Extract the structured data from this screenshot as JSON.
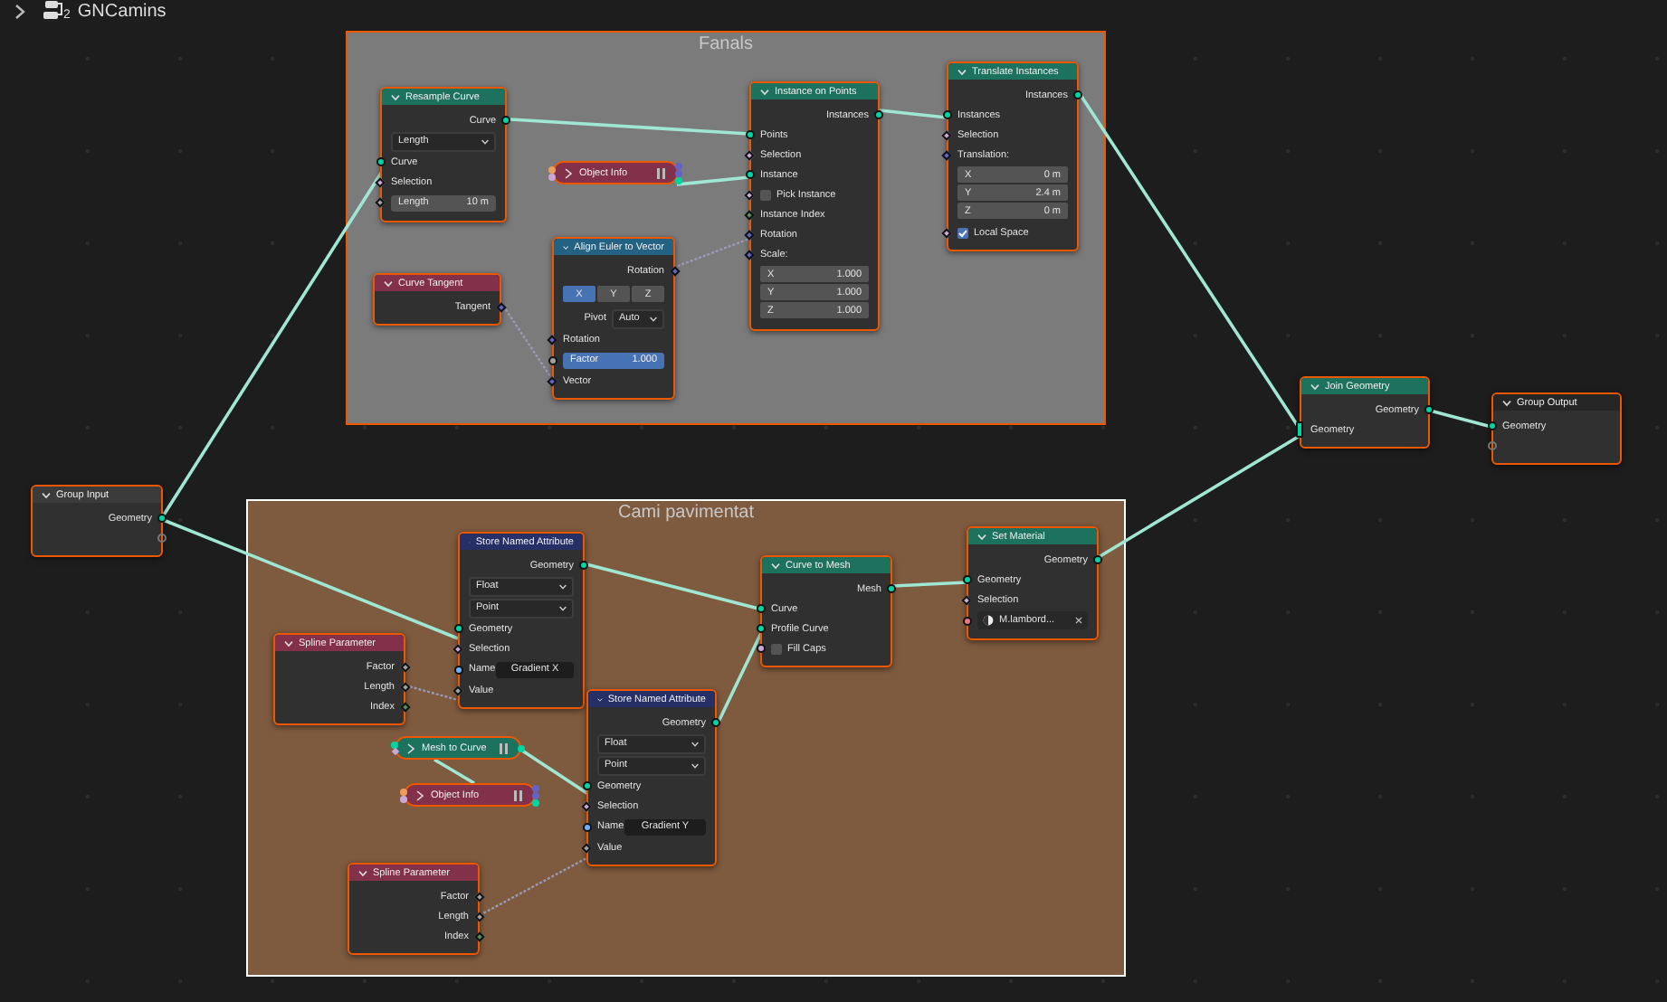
{
  "breadcrumb": {
    "name": "GNCamins",
    "users": "2"
  },
  "frames": [
    {
      "label": "Fanals",
      "color": "#7b7b7b",
      "active": false
    },
    {
      "label": "Cami pavimentat",
      "color": "#7e5a3e",
      "active": true
    }
  ],
  "nodes": [
    {
      "title": "Resample Curve",
      "color": "#1d725e",
      "selected": true,
      "collapsed": false,
      "rows": [
        {
          "kind": "output",
          "label": "Curve",
          "socket": {
            "kind": "circle",
            "color": "#00d6a3"
          }
        },
        {
          "kind": "dropdown",
          "value": "Length"
        },
        {
          "kind": "input",
          "label": "Curve",
          "socket": {
            "kind": "circle",
            "color": "#00d6a3"
          }
        },
        {
          "kind": "input",
          "label": "Selection",
          "socket": {
            "kind": "diamond",
            "color": "#cca6d6"
          }
        },
        {
          "kind": "number",
          "label": "Length",
          "value": "10 m",
          "socket": {
            "kind": "diamond",
            "color": "#a1a1a1"
          }
        }
      ]
    },
    {
      "title": "Curve Tangent",
      "color": "#83314a",
      "selected": true,
      "collapsed": false,
      "rows": [
        {
          "kind": "output",
          "label": "Tangent",
          "socket": {
            "kind": "diamond",
            "color": "#6363c7"
          }
        }
      ]
    },
    {
      "title": "Object Info",
      "color": "#83314a",
      "selected": true,
      "collapsed": true,
      "inputs": [
        {
          "kind": "circle",
          "color": "#ed9e5c"
        },
        {
          "kind": "circle",
          "color": "#cca6d6"
        }
      ],
      "outputs": [
        {
          "kind": "circle",
          "color": "#6363c7"
        },
        {
          "kind": "circle",
          "color": "#6363c7"
        },
        {
          "kind": "circle",
          "color": "#00d6a3"
        }
      ]
    },
    {
      "title": "Align Euler to Vector",
      "color": "#246283",
      "selected": true,
      "collapsed": false,
      "rows": [
        {
          "kind": "output",
          "label": "Rotation",
          "socket": {
            "kind": "diamond",
            "color": "#6363c7"
          }
        },
        {
          "kind": "toggles",
          "items": [
            {
              "label": "X",
              "selected": true
            },
            {
              "label": "Y",
              "selected": false
            },
            {
              "label": "Z",
              "selected": false
            }
          ]
        },
        {
          "kind": "dropdown",
          "label": "Pivot",
          "value": "Auto"
        },
        {
          "kind": "input",
          "label": "Rotation",
          "socket": {
            "kind": "diamond",
            "color": "#6363c7"
          }
        },
        {
          "kind": "slider",
          "label": "Factor",
          "value": "1.000",
          "level": 1,
          "socket": {
            "kind": "circle",
            "color": "#a1a1a1"
          }
        },
        {
          "kind": "input",
          "label": "Vector",
          "socket": {
            "kind": "diamond",
            "color": "#6363c7"
          }
        }
      ]
    },
    {
      "title": "Instance on Points",
      "color": "#1d725e",
      "selected": true,
      "collapsed": false,
      "rows": [
        {
          "kind": "output",
          "label": "Instances",
          "socket": {
            "kind": "circle",
            "color": "#00d6a3"
          }
        },
        {
          "kind": "input",
          "label": "Points",
          "socket": {
            "kind": "circle",
            "color": "#00d6a3"
          }
        },
        {
          "kind": "input",
          "label": "Selection",
          "socket": {
            "kind": "diamond",
            "color": "#cca6d6"
          }
        },
        {
          "kind": "input",
          "label": "Instance",
          "socket": {
            "kind": "circle",
            "color": "#00d6a3"
          }
        },
        {
          "kind": "checkbox",
          "label": "Pick Instance",
          "checked": false,
          "socket": {
            "kind": "diamond",
            "color": "#cca6d6"
          }
        },
        {
          "kind": "input",
          "label": "Instance Index",
          "socket": {
            "kind": "diamond",
            "color": "#598c5c"
          }
        },
        {
          "kind": "input",
          "label": "Rotation",
          "socket": {
            "kind": "diamond",
            "color": "#6363c7"
          }
        },
        {
          "kind": "input",
          "label": "Scale:",
          "socket": {
            "kind": "diamond",
            "color": "#6363c7"
          }
        },
        {
          "kind": "vector",
          "items": [
            {
              "label": "X",
              "value": "1.000"
            },
            {
              "label": "Y",
              "value": "1.000"
            },
            {
              "label": "Z",
              "value": "1.000"
            }
          ]
        }
      ]
    },
    {
      "title": "Translate Instances",
      "color": "#1d725e",
      "selected": true,
      "collapsed": false,
      "rows": [
        {
          "kind": "output",
          "label": "Instances",
          "socket": {
            "kind": "circle",
            "color": "#00d6a3"
          }
        },
        {
          "kind": "input",
          "label": "Instances",
          "socket": {
            "kind": "circle",
            "color": "#00d6a3"
          }
        },
        {
          "kind": "input",
          "label": "Selection",
          "socket": {
            "kind": "diamond",
            "color": "#cca6d6"
          }
        },
        {
          "kind": "input",
          "label": "Translation:",
          "socket": {
            "kind": "diamond",
            "color": "#6363c7"
          }
        },
        {
          "kind": "vector",
          "items": [
            {
              "label": "X",
              "value": "0 m"
            },
            {
              "label": "Y",
              "value": "2.4 m"
            },
            {
              "label": "Z",
              "value": "0 m"
            }
          ]
        },
        {
          "kind": "checkbox",
          "label": "Local Space",
          "checked": true,
          "socket": {
            "kind": "diamond",
            "color": "#cca6d6"
          }
        }
      ]
    },
    {
      "title": "Group Input",
      "color": "#3b3b3b",
      "selected": true,
      "collapsed": false,
      "rows": [
        {
          "kind": "output",
          "label": "Geometry",
          "socket": {
            "kind": "circle",
            "color": "#00d6a3"
          }
        },
        {
          "kind": "output",
          "socket": {
            "kind": "virtual"
          }
        }
      ]
    },
    {
      "title": "Join Geometry",
      "color": "#1d725e",
      "selected": true,
      "collapsed": false,
      "rows": [
        {
          "kind": "output",
          "label": "Geometry",
          "socket": {
            "kind": "circle",
            "color": "#00d6a3"
          }
        },
        {
          "kind": "input",
          "label": "Geometry",
          "socket": {
            "kind": "multi",
            "color": "#00d6a3"
          }
        }
      ]
    },
    {
      "title": "Group Output",
      "color": "#262626",
      "selected": true,
      "collapsed": false,
      "rows": [
        {
          "kind": "input",
          "label": "Geometry",
          "socket": {
            "kind": "circle",
            "color": "#00d6a3"
          }
        },
        {
          "kind": "input",
          "socket": {
            "kind": "virtual"
          }
        }
      ]
    },
    {
      "title": "Store Named Attribute",
      "color": "#273066",
      "selected": true,
      "collapsed": false,
      "rows": [
        {
          "kind": "output",
          "label": "Geometry",
          "socket": {
            "kind": "circle",
            "color": "#00d6a3"
          }
        },
        {
          "kind": "dropdown",
          "value": "Float"
        },
        {
          "kind": "dropdown",
          "value": "Point"
        },
        {
          "kind": "input",
          "label": "Geometry",
          "socket": {
            "kind": "circle",
            "color": "#00d6a3"
          }
        },
        {
          "kind": "input",
          "label": "Selection",
          "socket": {
            "kind": "diamond",
            "color": "#cca6d6"
          }
        },
        {
          "kind": "text",
          "label": "Name",
          "value": "Gradient X",
          "socket": {
            "kind": "circle",
            "color": "#70b2ff"
          }
        },
        {
          "kind": "input",
          "label": "Value",
          "socket": {
            "kind": "diamond",
            "color": "#a1a1a1"
          }
        }
      ]
    },
    {
      "title": "Spline Parameter",
      "color": "#83314a",
      "selected": true,
      "collapsed": false,
      "rows": [
        {
          "kind": "output",
          "label": "Factor",
          "socket": {
            "kind": "diamond",
            "color": "#a1a1a1"
          }
        },
        {
          "kind": "output",
          "label": "Length",
          "socket": {
            "kind": "diamond",
            "color": "#a1a1a1"
          }
        },
        {
          "kind": "output",
          "label": "Index",
          "socket": {
            "kind": "diamond",
            "color": "#598c5c"
          }
        }
      ]
    },
    {
      "title": "Mesh to Curve",
      "color": "#1d725e",
      "selected": true,
      "collapsed": true,
      "inputs": [
        {
          "kind": "circle",
          "color": "#00d6a3"
        },
        {
          "kind": "diamond",
          "color": "#cca6d6"
        }
      ],
      "outputs": [
        {
          "kind": "circle",
          "color": "#00d6a3"
        }
      ]
    },
    {
      "title": "Object Info",
      "color": "#83314a",
      "selected": true,
      "collapsed": true,
      "inputs": [
        {
          "kind": "circle",
          "color": "#ed9e5c"
        },
        {
          "kind": "circle",
          "color": "#cca6d6"
        }
      ],
      "outputs": [
        {
          "kind": "circle",
          "color": "#6363c7"
        },
        {
          "kind": "circle",
          "color": "#6363c7"
        },
        {
          "kind": "circle",
          "color": "#00d6a3"
        }
      ]
    },
    {
      "title": "Store Named Attribute",
      "color": "#273066",
      "selected": true,
      "collapsed": false,
      "rows": [
        {
          "kind": "output",
          "label": "Geometry",
          "socket": {
            "kind": "circle",
            "color": "#00d6a3"
          }
        },
        {
          "kind": "dropdown",
          "value": "Float"
        },
        {
          "kind": "dropdown",
          "value": "Point"
        },
        {
          "kind": "input",
          "label": "Geometry",
          "socket": {
            "kind": "circle",
            "color": "#00d6a3"
          }
        },
        {
          "kind": "input",
          "label": "Selection",
          "socket": {
            "kind": "diamond",
            "color": "#cca6d6"
          }
        },
        {
          "kind": "text",
          "label": "Name",
          "value": "Gradient Y",
          "socket": {
            "kind": "circle",
            "color": "#70b2ff"
          }
        },
        {
          "kind": "input",
          "label": "Value",
          "socket": {
            "kind": "diamond",
            "color": "#a1a1a1"
          }
        }
      ]
    },
    {
      "title": "Spline Parameter",
      "color": "#83314a",
      "selected": true,
      "collapsed": false,
      "rows": [
        {
          "kind": "output",
          "label": "Factor",
          "socket": {
            "kind": "diamond",
            "color": "#a1a1a1"
          }
        },
        {
          "kind": "output",
          "label": "Length",
          "socket": {
            "kind": "diamond",
            "color": "#a1a1a1"
          }
        },
        {
          "kind": "output",
          "label": "Index",
          "socket": {
            "kind": "diamond",
            "color": "#598c5c"
          }
        }
      ]
    },
    {
      "title": "Curve to Mesh",
      "color": "#1d725e",
      "selected": true,
      "collapsed": false,
      "rows": [
        {
          "kind": "output",
          "label": "Mesh",
          "socket": {
            "kind": "circle",
            "color": "#00d6a3"
          }
        },
        {
          "kind": "input",
          "label": "Curve",
          "socket": {
            "kind": "circle",
            "color": "#00d6a3"
          }
        },
        {
          "kind": "input",
          "label": "Profile Curve",
          "socket": {
            "kind": "circle",
            "color": "#00d6a3"
          }
        },
        {
          "kind": "checkbox",
          "label": "Fill Caps",
          "checked": false,
          "socket": {
            "kind": "circle",
            "color": "#cca6d6"
          }
        }
      ]
    },
    {
      "title": "Set Material",
      "color": "#1d725e",
      "selected": true,
      "collapsed": false,
      "rows": [
        {
          "kind": "output",
          "label": "Geometry",
          "socket": {
            "kind": "circle",
            "color": "#00d6a3"
          }
        },
        {
          "kind": "input",
          "label": "Geometry",
          "socket": {
            "kind": "circle",
            "color": "#00d6a3"
          }
        },
        {
          "kind": "input",
          "label": "Selection",
          "socket": {
            "kind": "diamond",
            "color": "#cca6d6"
          }
        },
        {
          "kind": "material",
          "value": "M.lambord...",
          "socket": {
            "kind": "circle",
            "color": "#eb7582"
          }
        }
      ]
    }
  ]
}
